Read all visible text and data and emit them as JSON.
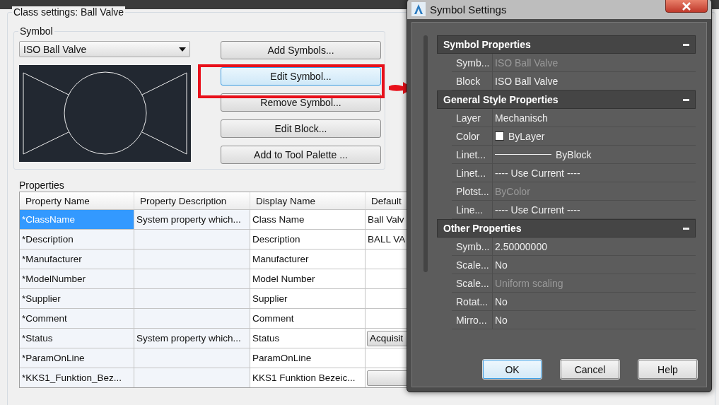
{
  "class_settings": {
    "title": "Class settings: Ball Valve",
    "symbol": {
      "label": "Symbol",
      "dropdown": "ISO Ball Valve",
      "buttons": [
        {
          "label": "Add Symbols...",
          "highlighted": false
        },
        {
          "label": "Edit Symbol...",
          "highlighted": true
        },
        {
          "label": "Remove Symbol...",
          "highlighted": false
        },
        {
          "label": "Edit Block...",
          "highlighted": false
        },
        {
          "label": "Add to Tool Palette ...",
          "highlighted": false
        }
      ]
    },
    "properties": {
      "label": "Properties",
      "columns": [
        "Property Name",
        "Property Description",
        "Display Name",
        "Default"
      ],
      "rows": [
        {
          "name": "*ClassName",
          "description": "System property which...",
          "display": "Class Name",
          "default": {
            "kind": "text",
            "text": "Ball Valv"
          },
          "selected": true
        },
        {
          "name": "*Description",
          "display": "Description",
          "default": {
            "kind": "text",
            "text": "BALL VA"
          },
          "selected": false
        },
        {
          "name": "*Manufacturer",
          "display": "Manufacturer",
          "selected": false
        },
        {
          "name": "*ModelNumber",
          "display": "Model Number",
          "selected": false
        },
        {
          "name": "*Supplier",
          "display": "Supplier",
          "selected": false
        },
        {
          "name": "*Comment",
          "display": "Comment",
          "selected": false
        },
        {
          "name": "*Status",
          "description": "System property which...",
          "display": "Status",
          "default": {
            "kind": "button",
            "text": "Acquisit"
          },
          "selected": false
        },
        {
          "name": "*ParamOnLine",
          "display": "ParamOnLine",
          "selected": false
        },
        {
          "name": "*KKS1_Funktion_Bez...",
          "display": "KKS1 Funktion Bezeic...",
          "default": {
            "kind": "button"
          },
          "selected": false
        }
      ]
    }
  },
  "dialog": {
    "title": "Symbol Settings",
    "sections": [
      {
        "title": "Symbol Properties",
        "expanded": true,
        "rows": [
          {
            "label": "Symb...",
            "value": "ISO Ball Valve",
            "kind": "text",
            "disabled": true
          },
          {
            "label": "Block",
            "value": "ISO Ball Valve",
            "kind": "text",
            "disabled": false
          }
        ]
      },
      {
        "title": "General Style Properties",
        "expanded": true,
        "rows": [
          {
            "label": "Layer",
            "value": "Mechanisch",
            "kind": "text",
            "disabled": false
          },
          {
            "label": "Color",
            "value": "ByLayer",
            "kind": "color",
            "color": "#ffffff",
            "disabled": false
          },
          {
            "label": "Linet...",
            "value": "ByBlock",
            "kind": "linetype",
            "disabled": false
          },
          {
            "label": "Linet...",
            "value": "---- Use Current ----",
            "kind": "text",
            "disabled": false
          },
          {
            "label": "Plotst...",
            "value": "ByColor",
            "kind": "text",
            "disabled": true
          },
          {
            "label": "Line...",
            "value": "---- Use Current ----",
            "kind": "text",
            "disabled": false
          }
        ]
      },
      {
        "title": "Other Properties",
        "expanded": true,
        "rows": [
          {
            "label": "Symb...",
            "value": "2.50000000",
            "kind": "text",
            "disabled": false
          },
          {
            "label": "Scale...",
            "value": "No",
            "kind": "text",
            "disabled": false
          },
          {
            "label": "Scale...",
            "value": "Uniform scaling",
            "kind": "text",
            "disabled": true
          },
          {
            "label": "Rotat...",
            "value": "No",
            "kind": "text",
            "disabled": false
          },
          {
            "label": "Mirro...",
            "value": "No",
            "kind": "text",
            "disabled": false
          }
        ]
      }
    ],
    "buttons": [
      {
        "label": "OK",
        "default": true
      },
      {
        "label": "Cancel",
        "default": false
      },
      {
        "label": "Help",
        "default": false
      }
    ]
  }
}
